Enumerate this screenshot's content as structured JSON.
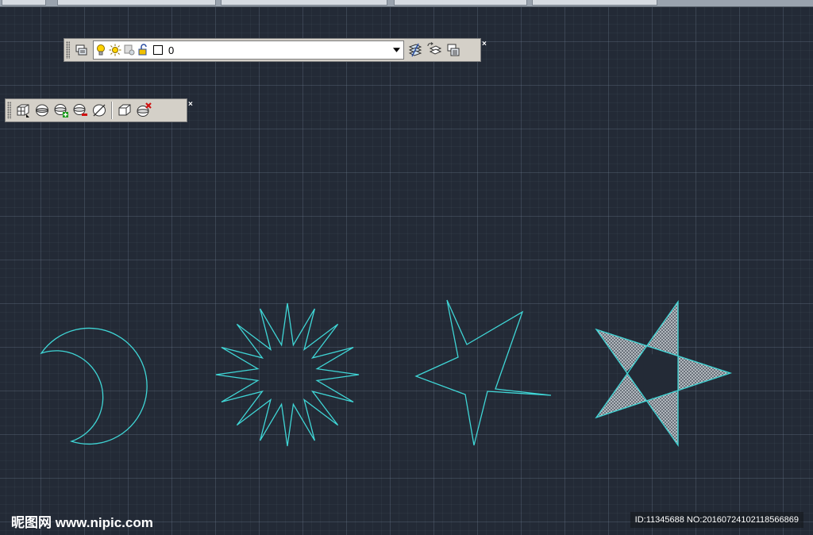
{
  "layers_toolbar": {
    "current_layer": "0",
    "buttons": [
      "layer-properties-icon",
      "on-off-bulb-icon",
      "freeze-sun-icon",
      "viewport-freeze-icon",
      "lock-icon",
      "color-swatch-icon",
      "make-current-icon",
      "layer-previous-icon",
      "layer-state-icon"
    ],
    "close_label": "×"
  },
  "view_toolbar": {
    "buttons": [
      "3d-box-icon",
      "named-views-icon",
      "add-view-icon",
      "delete-view-icon",
      "no-view-icon",
      "box-view-icon",
      "close-view-icon"
    ],
    "close_label": "×"
  },
  "drawing": {
    "shapes": [
      "crescent-moon",
      "sun",
      "star-outline",
      "star-hatched"
    ],
    "stroke_color": "#3fd6d6",
    "hatch_color": "#b9c0c6"
  },
  "watermark": {
    "site": "昵图网 www.nipic.com",
    "id_text": "ID:11345688 NO:20160724102118566869"
  }
}
